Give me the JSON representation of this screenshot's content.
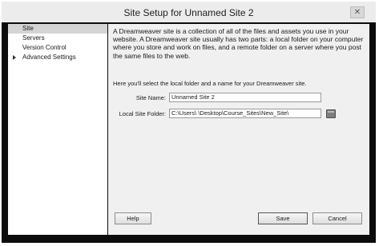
{
  "window": {
    "title": "Site Setup for Unnamed Site 2",
    "close_label": "✕"
  },
  "sidebar": {
    "items": [
      {
        "label": "Site",
        "selected": true
      },
      {
        "label": "Servers"
      },
      {
        "label": "Version Control"
      },
      {
        "label": "Advanced Settings",
        "expandable": true
      }
    ]
  },
  "main": {
    "description": "A Dreamweaver site is a collection of all of the files and assets you use in your website. A Dreamweaver site usually has two parts: a local folder on your computer where you store and work on files, and a remote folder on a server where you post the same files to the web.",
    "instruction": "Here you'll select the local folder and a name for your Dreamweaver site.",
    "site_name_label": "Site Name:",
    "site_name_value": "Unnamed Site 2",
    "local_folder_label": "Local Site Folder:",
    "local_folder_value": "C:\\Users\\          \\Desktop\\Course_Sites\\New_Site\\"
  },
  "buttons": {
    "help": "Help",
    "save": "Save",
    "cancel": "Cancel"
  },
  "colors": {
    "frame": "#0c0c0c",
    "titlebar": "#ececec",
    "content_bg": "#f0f0f0",
    "selection": "#d4d4d4"
  },
  "icons": {
    "close": "close-icon",
    "browse": "folder-icon",
    "expand": "caret-right-icon"
  }
}
